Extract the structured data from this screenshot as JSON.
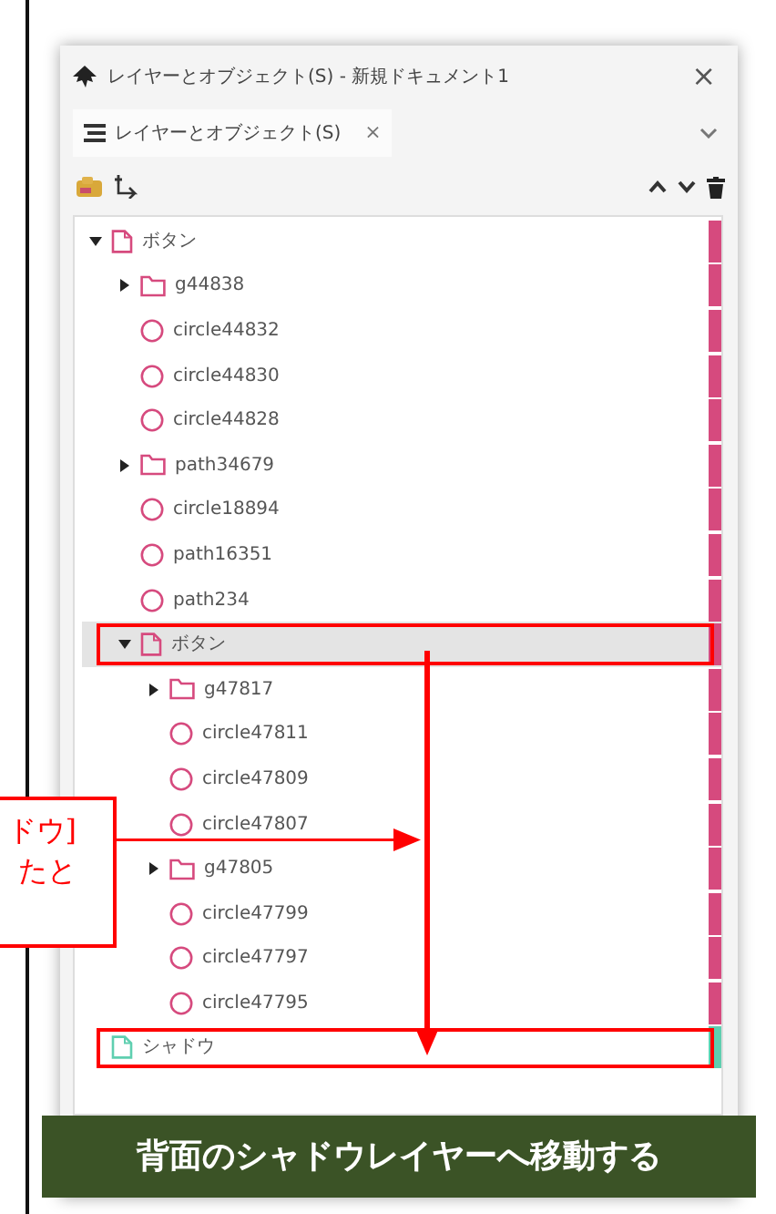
{
  "dialog": {
    "title": "レイヤーとオブジェクト(S) - 新規ドキュメント1",
    "close": "×",
    "tab": {
      "label": "レイヤーとオブジェクト(S)",
      "close": "×",
      "selected": true
    }
  },
  "tree": [
    {
      "kind": "layer",
      "label": "ボタン",
      "expanded": true,
      "selected": false,
      "color": "#d64a7e",
      "children": [
        {
          "kind": "group",
          "label": "g44838",
          "expanded": false,
          "selected": false
        },
        {
          "kind": "circle",
          "label": "circle44832",
          "selected": false
        },
        {
          "kind": "circle",
          "label": "circle44830",
          "selected": false
        },
        {
          "kind": "circle",
          "label": "circle44828",
          "selected": false
        },
        {
          "kind": "group",
          "label": "path34679",
          "expanded": false,
          "selected": false
        },
        {
          "kind": "circle",
          "label": "circle18894",
          "selected": false
        },
        {
          "kind": "circle",
          "label": "path16351",
          "selected": false
        },
        {
          "kind": "circle",
          "label": "path234",
          "selected": false
        },
        {
          "kind": "layer",
          "label": "ボタン",
          "expanded": true,
          "selected": true,
          "children": [
            {
              "kind": "group",
              "label": "g47817",
              "expanded": false,
              "selected": false
            },
            {
              "kind": "circle",
              "label": "circle47811",
              "selected": false
            },
            {
              "kind": "circle",
              "label": "circle47809",
              "selected": false
            },
            {
              "kind": "circle",
              "label": "circle47807",
              "selected": false
            },
            {
              "kind": "group",
              "label": "g47805",
              "expanded": false,
              "selected": false
            },
            {
              "kind": "circle",
              "label": "circle47799",
              "selected": false
            },
            {
              "kind": "circle",
              "label": "circle47797",
              "selected": false
            },
            {
              "kind": "circle",
              "label": "circle47795",
              "selected": false
            }
          ]
        }
      ]
    },
    {
      "kind": "layer",
      "label": "シャドウ",
      "selected": false,
      "color": "#5fcfb0"
    }
  ],
  "annotations": {
    "callout": {
      "lines": [
        "ドウ]",
        "たと"
      ]
    },
    "caption": "背面のシャドウレイヤーへ移動する"
  }
}
